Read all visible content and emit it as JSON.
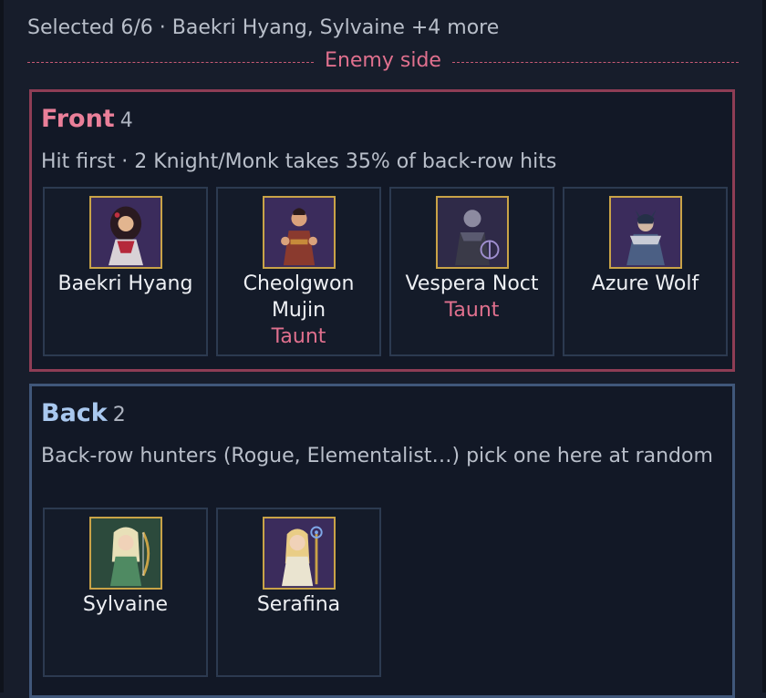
{
  "summary": "Selected 6/6 · Baekri Hyang, Sylvaine +4 more",
  "divider_label": "Enemy side",
  "colors": {
    "front_accent": "#8e3d55",
    "back_accent": "#40577a",
    "taunt": "#e0708e",
    "portrait_border": "#c9a347"
  },
  "front": {
    "title": "Front",
    "count": "4",
    "description": "Hit first · 2 Knight/Monk takes 35% of back-row hits",
    "units": [
      {
        "name": "Baekri Hyang",
        "tag": "",
        "portrait": "dancer-portrait"
      },
      {
        "name": "Cheolgwon Mujin",
        "tag": "Taunt",
        "portrait": "monk-portrait"
      },
      {
        "name": "Vespera Noct",
        "tag": "Taunt",
        "portrait": "dark-knight-portrait"
      },
      {
        "name": "Azure Wolf",
        "tag": "",
        "portrait": "wolf-warrior-portrait"
      }
    ]
  },
  "back": {
    "title": "Back",
    "count": "2",
    "description": "Back-row hunters (Rogue, Elementalist…) pick one here at random",
    "units": [
      {
        "name": "Sylvaine",
        "tag": "",
        "portrait": "archer-portrait"
      },
      {
        "name": "Serafina",
        "tag": "",
        "portrait": "priestess-portrait"
      }
    ]
  }
}
